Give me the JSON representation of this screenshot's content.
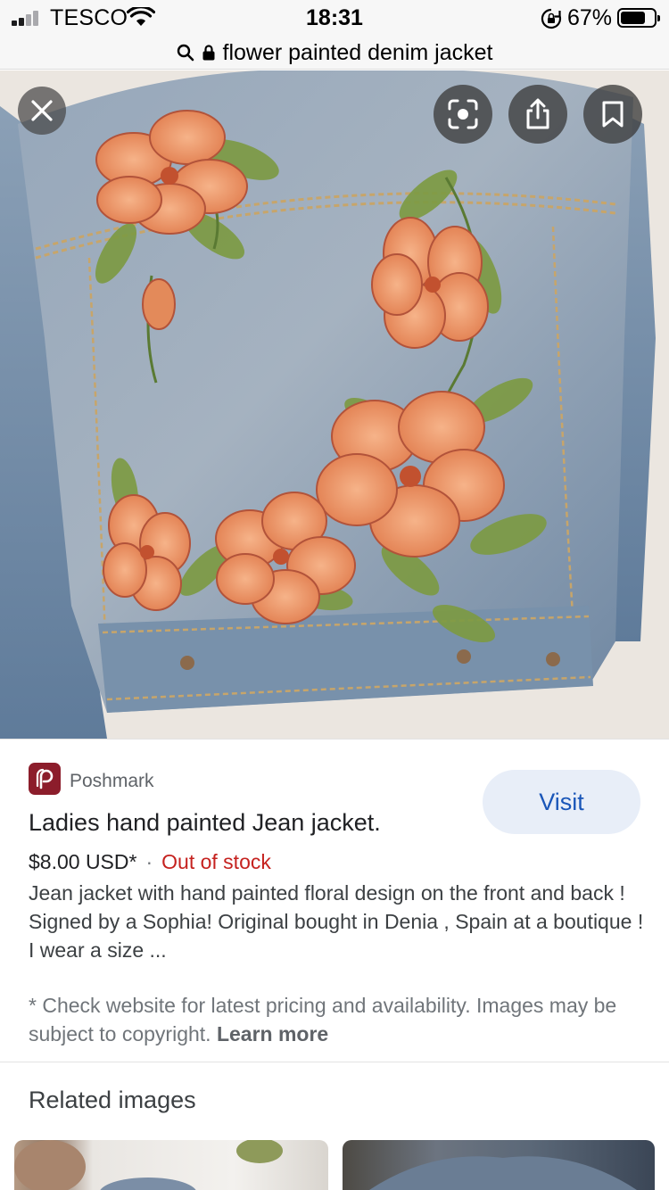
{
  "status_bar": {
    "carrier": "TESCO",
    "time": "18:31",
    "battery": "67%",
    "battery_level": 0.67,
    "signal_icon": "cellular-signal-icon",
    "wifi_icon": "wifi-icon",
    "rotation_lock_icon": "rotation-lock-icon"
  },
  "url_bar": {
    "query": "flower painted denim jacket",
    "search_icon": "search-icon",
    "lock_icon": "lock-icon"
  },
  "image_viewer": {
    "image_alt": "Hand painted floral denim jacket, back view",
    "close_icon": "close-icon",
    "lens_icon": "lens-icon",
    "share_icon": "share-icon",
    "bookmark_icon": "bookmark-icon"
  },
  "result": {
    "source": "Poshmark",
    "source_logo_icon": "poshmark-logo-icon",
    "visit_label": "Visit",
    "title": "Ladies hand painted Jean jacket.",
    "price": "$8.00 USD*",
    "separator": "·",
    "stock_status": "Out of stock",
    "description": "Jean jacket with hand painted floral design on the front and back ! Signed by a Sophia! Original bought in Denia , Spain at a boutique ! I wear a size ...",
    "disclaimer": "* Check website for latest pricing and availability. Images may be subject to copyright.",
    "learn_more": "Learn more"
  },
  "related": {
    "heading": "Related images"
  },
  "colors": {
    "accent_blue": "#1a56b8",
    "visit_bg": "#e8eef8",
    "out_of_stock": "#c5221f",
    "poshmark": "#8c1d2b",
    "denim": "#7d93ad",
    "flower": "#ee9a66"
  }
}
